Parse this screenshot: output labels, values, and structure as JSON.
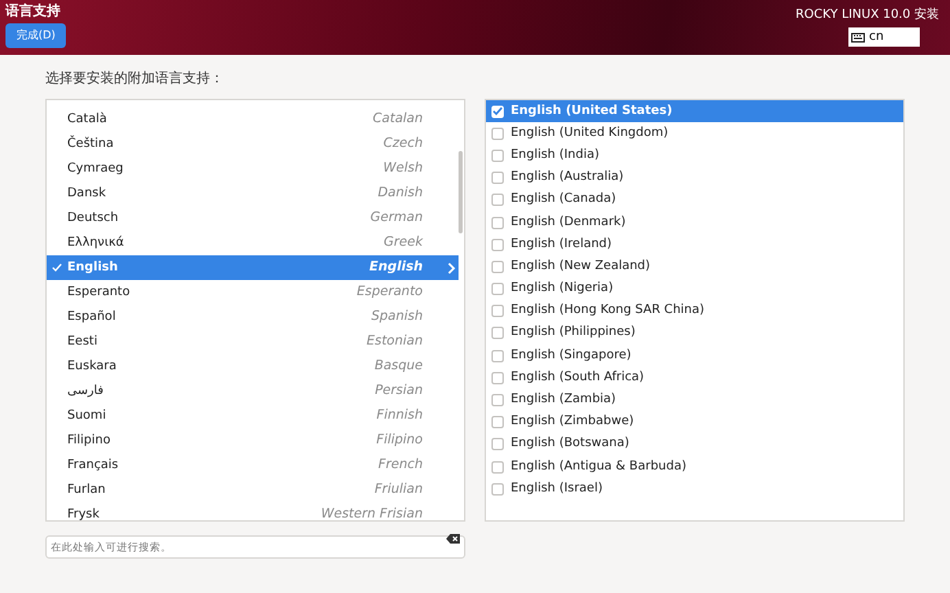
{
  "header": {
    "title": "语言支持",
    "done_button": "完成(D)",
    "product": "ROCKY LINUX 10.0 安装",
    "keyboard_layout": "cn"
  },
  "prompt": "选择要安装的附加语言支持：",
  "languages": [
    {
      "native": "Català",
      "english": "Catalan",
      "selected": false
    },
    {
      "native": "Čeština",
      "english": "Czech",
      "selected": false
    },
    {
      "native": "Cymraeg",
      "english": "Welsh",
      "selected": false
    },
    {
      "native": "Dansk",
      "english": "Danish",
      "selected": false
    },
    {
      "native": "Deutsch",
      "english": "German",
      "selected": false
    },
    {
      "native": "Ελληνικά",
      "english": "Greek",
      "selected": false
    },
    {
      "native": "English",
      "english": "English",
      "selected": true
    },
    {
      "native": "Esperanto",
      "english": "Esperanto",
      "selected": false
    },
    {
      "native": "Español",
      "english": "Spanish",
      "selected": false
    },
    {
      "native": "Eesti",
      "english": "Estonian",
      "selected": false
    },
    {
      "native": "Euskara",
      "english": "Basque",
      "selected": false
    },
    {
      "native": "فارسی",
      "english": "Persian",
      "selected": false
    },
    {
      "native": "Suomi",
      "english": "Finnish",
      "selected": false
    },
    {
      "native": "Filipino",
      "english": "Filipino",
      "selected": false
    },
    {
      "native": "Français",
      "english": "French",
      "selected": false
    },
    {
      "native": "Furlan",
      "english": "Friulian",
      "selected": false
    },
    {
      "native": "Frysk",
      "english": "Western Frisian",
      "selected": false
    }
  ],
  "search": {
    "placeholder": "在此处输入可进行搜索。"
  },
  "locales": [
    {
      "label": "English (United States)",
      "checked": true,
      "selected": true
    },
    {
      "label": "English (United Kingdom)",
      "checked": false,
      "selected": false
    },
    {
      "label": "English (India)",
      "checked": false,
      "selected": false
    },
    {
      "label": "English (Australia)",
      "checked": false,
      "selected": false
    },
    {
      "label": "English (Canada)",
      "checked": false,
      "selected": false
    },
    {
      "label": "English (Denmark)",
      "checked": false,
      "selected": false
    },
    {
      "label": "English (Ireland)",
      "checked": false,
      "selected": false
    },
    {
      "label": "English (New Zealand)",
      "checked": false,
      "selected": false
    },
    {
      "label": "English (Nigeria)",
      "checked": false,
      "selected": false
    },
    {
      "label": "English (Hong Kong SAR China)",
      "checked": false,
      "selected": false
    },
    {
      "label": "English (Philippines)",
      "checked": false,
      "selected": false
    },
    {
      "label": "English (Singapore)",
      "checked": false,
      "selected": false
    },
    {
      "label": "English (South Africa)",
      "checked": false,
      "selected": false
    },
    {
      "label": "English (Zambia)",
      "checked": false,
      "selected": false
    },
    {
      "label": "English (Zimbabwe)",
      "checked": false,
      "selected": false
    },
    {
      "label": "English (Botswana)",
      "checked": false,
      "selected": false
    },
    {
      "label": "English (Antigua & Barbuda)",
      "checked": false,
      "selected": false
    },
    {
      "label": "English (Israel)",
      "checked": false,
      "selected": false
    }
  ]
}
